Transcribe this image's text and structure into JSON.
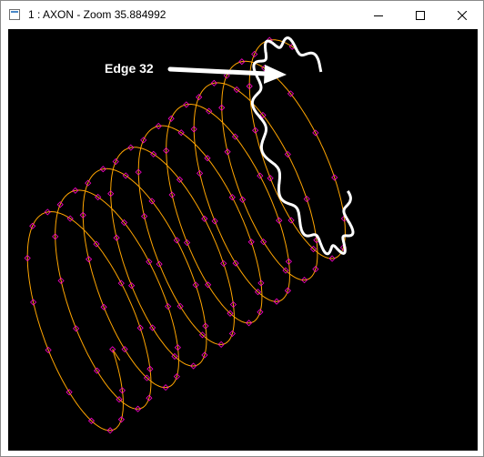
{
  "window": {
    "title": "1 : AXON - Zoom 35.884992"
  },
  "titlebar": {
    "icons": [
      "app-icon",
      "minimize-icon",
      "maximize-icon",
      "close-icon"
    ]
  },
  "viewport": {
    "annotation_label": "Edge 32",
    "colors": {
      "background": "#000000",
      "helix_curve": "#ffa500",
      "vertex_marker": "#ff00cc",
      "highlighted_edge": "#ffffff",
      "annotation": "#ffffff"
    }
  }
}
